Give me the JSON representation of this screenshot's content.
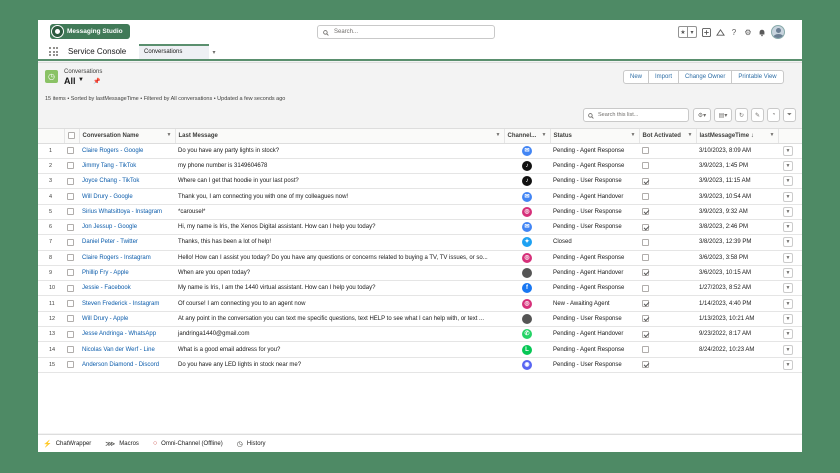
{
  "app": {
    "brand": "Messaging Studio",
    "search_placeholder": "Search...",
    "app_name": "Service Console",
    "nav_tab": "Conversations"
  },
  "list": {
    "object_label": "Conversations",
    "view_name": "All",
    "buttons": [
      "New",
      "Import",
      "Change Owner",
      "Printable View"
    ],
    "meta": "15 items • Sorted by lastMessageTime • Filtered by All conversations • Updated a few seconds ago",
    "search_placeholder": "Search this list...",
    "columns": [
      "Conversation Name",
      "Last Message",
      "Channel...",
      "Status",
      "Bot Activated",
      "lastMessageTime ↓"
    ]
  },
  "rows": [
    {
      "num": "1",
      "name": "Claire Rogers - Google",
      "message": "Do you have any party lights in stock?",
      "channel": "google",
      "status": "Pending - Agent Response",
      "bot": false,
      "time": "3/10/2023, 8:09 AM"
    },
    {
      "num": "2",
      "name": "Jimmy Tang - TikTok",
      "message": "my phone number is 3149604678",
      "channel": "tiktok",
      "status": "Pending - Agent Response",
      "bot": false,
      "time": "3/9/2023, 1:45 PM"
    },
    {
      "num": "3",
      "name": "Joyce Chang - TikTok",
      "message": "Where can I get that hoodie in your last post?",
      "channel": "tiktok",
      "status": "Pending - User Response",
      "bot": true,
      "time": "3/9/2023, 11:15 AM"
    },
    {
      "num": "4",
      "name": "Will Drury - Google",
      "message": "Thank you, I am connecting you with one of my colleagues now!",
      "channel": "google",
      "status": "Pending - Agent Handover",
      "bot": false,
      "time": "3/9/2023, 10:54 AM"
    },
    {
      "num": "5",
      "name": "Sirius Whatsittoya - Instagram",
      "message": "*carousel*",
      "channel": "instagram",
      "status": "Pending - User Response",
      "bot": true,
      "time": "3/9/2023, 9:32 AM"
    },
    {
      "num": "6",
      "name": "Jon Jessup - Google",
      "message": "Hi, my name is Iris, the Xenos Digital assistant. How can I help you today?",
      "channel": "google",
      "status": "Pending - User Response",
      "bot": true,
      "time": "3/8/2023, 2:46 PM"
    },
    {
      "num": "7",
      "name": "Daniel Peter - Twitter",
      "message": "Thanks, this has been a lot of help!",
      "channel": "twitter",
      "status": "Closed",
      "bot": false,
      "time": "3/8/2023, 12:39 PM"
    },
    {
      "num": "8",
      "name": "Claire Rogers - Instagram",
      "message": "Hello! How can I assist you today? Do you have any questions or concerns related to buying a TV, TV issues, or so...",
      "channel": "instagram",
      "status": "Pending - Agent Response",
      "bot": false,
      "time": "3/6/2023, 3:58 PM"
    },
    {
      "num": "9",
      "name": "Phillip Fry - Apple",
      "message": "When are you open today?",
      "channel": "apple",
      "status": "Pending - Agent Handover",
      "bot": true,
      "time": "3/6/2023, 10:15 AM"
    },
    {
      "num": "10",
      "name": "Jessie - Facebook",
      "message": "My name is Iris, I am the 1440 virtual assistant. How can I help you today?",
      "channel": "facebook",
      "status": "Pending - Agent Response",
      "bot": false,
      "time": "1/27/2023, 8:52 AM"
    },
    {
      "num": "11",
      "name": "Steven Frederick - Instagram",
      "message": "Of course! I am connecting you to an agent now",
      "channel": "instagram",
      "status": "New - Awaiting Agent",
      "bot": true,
      "time": "1/14/2023, 4:40 PM"
    },
    {
      "num": "12",
      "name": "Will Drury - Apple",
      "message": "At any point in the conversation you can text me specific questions, text HELP to see what I can help with, or text ...",
      "channel": "apple",
      "status": "Pending - User Response",
      "bot": true,
      "time": "1/13/2023, 10:21 AM"
    },
    {
      "num": "13",
      "name": "Jesse Andringa - WhatsApp",
      "message": "jandringa1440@gmail.com",
      "channel": "whatsapp",
      "status": "Pending - Agent Handover",
      "bot": true,
      "time": "9/23/2022, 8:17 AM"
    },
    {
      "num": "14",
      "name": "Nicolas Van der Werf - Line",
      "message": "What is a good email address for you?",
      "channel": "line",
      "status": "Pending - Agent Response",
      "bot": false,
      "time": "8/24/2022, 10:23 AM"
    },
    {
      "num": "15",
      "name": "Anderson Diamond - Discord",
      "message": "Do you have any LED lights in stock near me?",
      "channel": "discord",
      "status": "Pending - User Response",
      "bot": true,
      "time": ""
    }
  ],
  "footer": [
    "ChatWrapper",
    "Macros",
    "Omni-Channel (Offline)",
    "History"
  ],
  "channel_colors": {
    "google": "#4285f4",
    "tiktok": "#111111",
    "instagram": "#d6307a",
    "twitter": "#1da1f2",
    "apple": "#555555",
    "facebook": "#1877f2",
    "whatsapp": "#25d366",
    "line": "#06c755",
    "discord": "#5865f2"
  }
}
